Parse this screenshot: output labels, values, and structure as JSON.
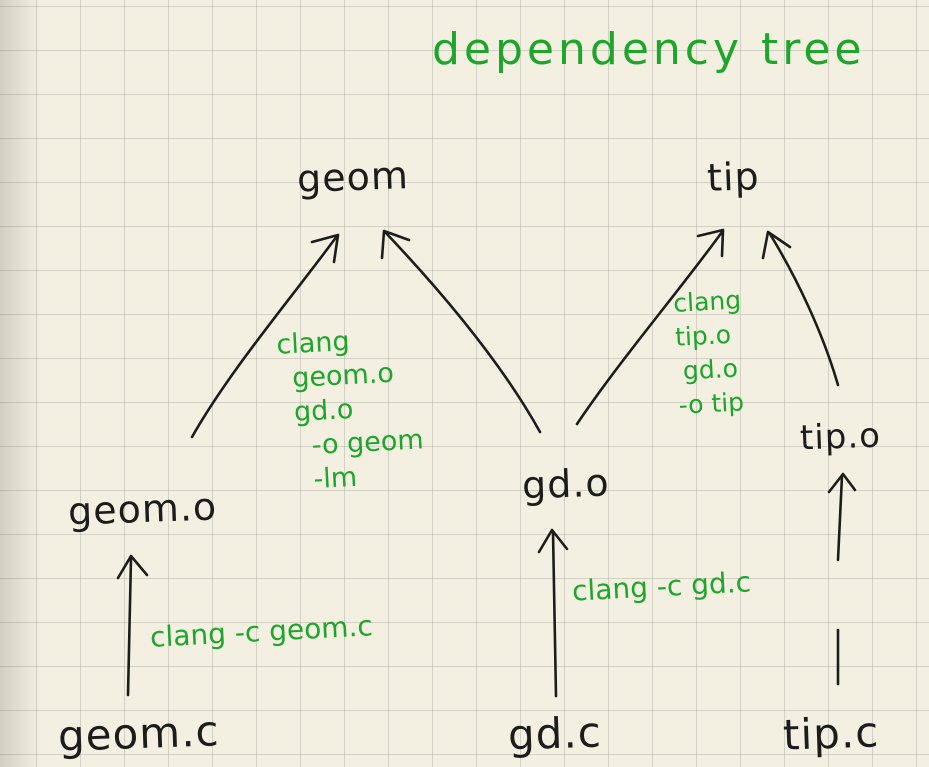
{
  "title": "dependency tree",
  "nodes": {
    "geom": "geom",
    "tip": "tip",
    "geom_o": "geom.o",
    "gd_o": "gd.o",
    "tip_o": "tip.o",
    "geom_c": "geom.c",
    "gd_c": "gd.c",
    "tip_c": "tip.c"
  },
  "commands": {
    "link_geom": [
      "clang",
      "geom.o",
      "gd.o",
      "-o geom",
      "-lm"
    ],
    "link_tip": [
      "clang",
      "tip.o",
      "gd.o",
      "-o tip"
    ],
    "compile_geom": "clang -c geom.c",
    "compile_gd": "clang -c gd.c"
  },
  "colors": {
    "paper": "#f3f0e2",
    "grid": "#aaaaa0",
    "ink": "#1c1c1c",
    "annotation": "#1ea52b"
  }
}
